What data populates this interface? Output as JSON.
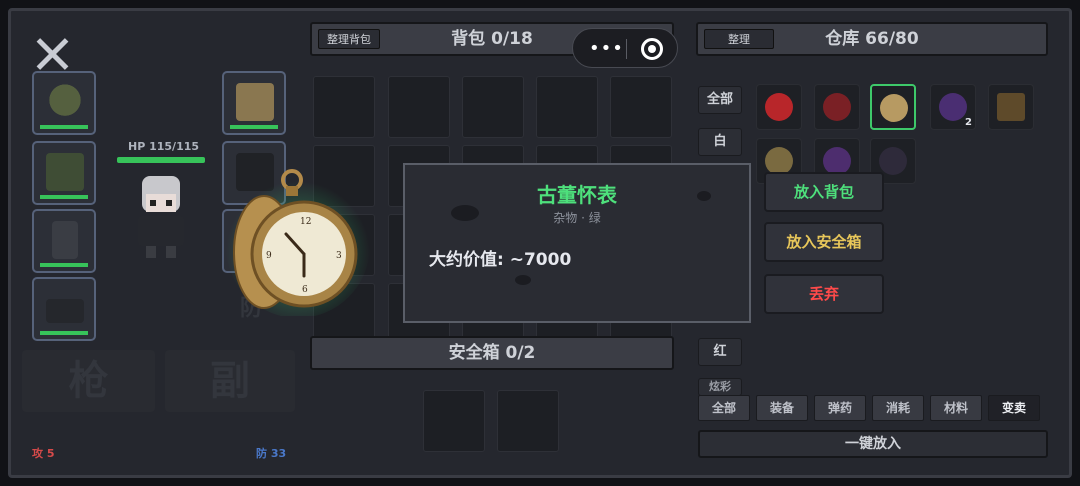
{
  "character": {
    "hp_label": "HP 115/115",
    "attack_label": "攻 5",
    "defense_label": "防 33",
    "weapon_slots": [
      "枪",
      "副"
    ]
  },
  "backpack": {
    "sort_button": "整理背包",
    "title": "背包 0/18",
    "safe_box_title": "安全箱 0/2"
  },
  "warehouse": {
    "sort_button": "整理",
    "title": "仓库 66/80",
    "quality_filters": [
      "全部",
      "白",
      "红",
      "炫彩"
    ],
    "category_filters": [
      "全部",
      "装备",
      "弹药",
      "消耗",
      "材料",
      "变卖"
    ],
    "put_all_button": "一键放入",
    "stack_count": "2"
  },
  "tooltip": {
    "item_name": "古董怀表",
    "item_category": "杂物 · 绿",
    "value_label": "大约价值: ~7000"
  },
  "actions": {
    "put_in_backpack": "放入背包",
    "put_in_safe": "放入安全箱",
    "discard": "丢弃"
  },
  "colors": {
    "green": "#4ee07c",
    "yellow": "#e8c75a",
    "red": "#ff4a4a",
    "durability": "#37c35a"
  },
  "hidden_slot_glyph": "防"
}
